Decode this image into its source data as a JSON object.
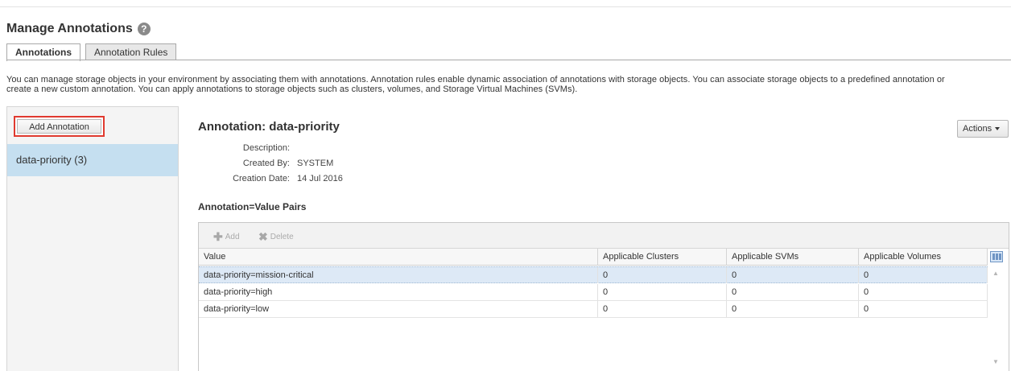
{
  "page": {
    "title": "Manage Annotations",
    "help_icon": "question-circle-icon"
  },
  "tabs": [
    {
      "label": "Annotations",
      "active": true
    },
    {
      "label": "Annotation Rules",
      "active": false
    }
  ],
  "intro_text": {
    "line1": "You can manage storage objects in your environment by associating them with annotations. Annotation rules enable dynamic association of annotations with storage objects. You can associate storage objects to a predefined annotation or",
    "line2": "create a new custom annotation. You can apply annotations to storage objects such as clusters, volumes, and Storage Virtual Machines (SVMs)."
  },
  "left_panel": {
    "add_button_label": "Add Annotation",
    "items": [
      {
        "label": "data-priority (3)",
        "selected": true
      }
    ]
  },
  "detail": {
    "title": "Annotation: data-priority",
    "actions_label": "Actions",
    "description_label": "Description:",
    "description_value": "",
    "created_by_label": "Created By:",
    "created_by_value": "SYSTEM",
    "creation_date_label": "Creation Date:",
    "creation_date_value": "14 Jul 2016",
    "pairs_title": "Annotation=Value Pairs"
  },
  "grid": {
    "toolbar": {
      "add_label": "Add",
      "add_icon": "plus-icon",
      "delete_label": "Delete",
      "delete_icon": "x-icon"
    },
    "columns": [
      "Value",
      "Applicable Clusters",
      "Applicable SVMs",
      "Applicable Volumes"
    ],
    "rows": [
      {
        "value": "data-priority=mission-critical",
        "clusters": "0",
        "svms": "0",
        "volumes": "0",
        "selected": true
      },
      {
        "value": "data-priority=high",
        "clusters": "0",
        "svms": "0",
        "volumes": "0",
        "selected": false
      },
      {
        "value": "data-priority=low",
        "clusters": "0",
        "svms": "0",
        "volumes": "0",
        "selected": false
      }
    ],
    "column_chooser_icon": "column-chooser-icon"
  },
  "colors": {
    "selected_item_bg": "#c5dff0",
    "highlight_border": "#e03a2f",
    "selected_row_bg": "#dde9f6"
  }
}
